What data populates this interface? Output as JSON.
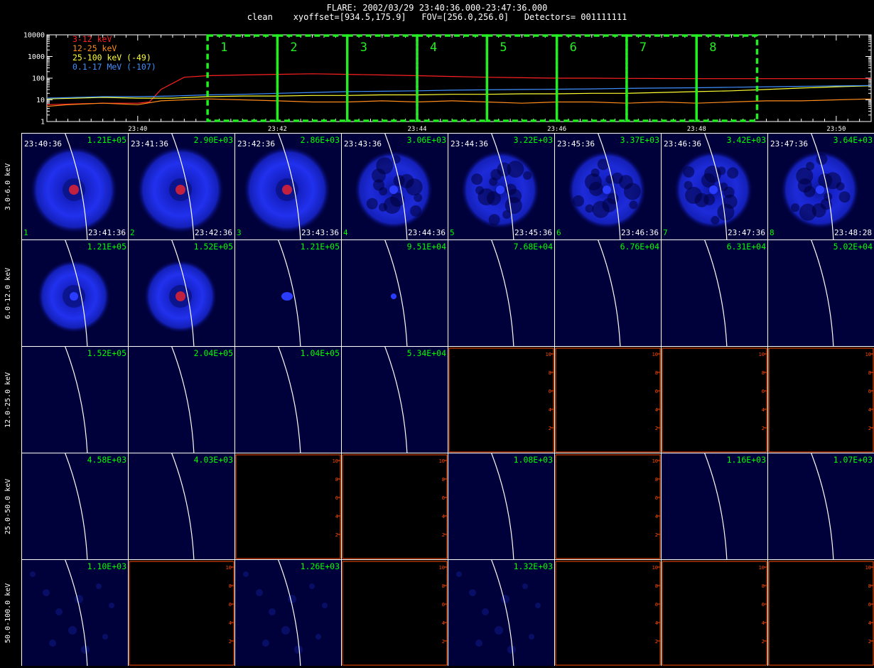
{
  "header": {
    "title": "FLARE: 2002/03/29 23:40:36.000-23:47:36.000",
    "subtitle": "clean    xyoffset=[934.5,175.9]   FOV=[256.0,256.0]   Detectors= 001111111"
  },
  "chart_data": [
    {
      "type": "line",
      "scale": "log",
      "ylim": [
        1,
        10000
      ],
      "yticks": [
        "10000",
        "1000",
        "100",
        "10",
        "1"
      ],
      "xticks": [
        "23:40",
        "23:42",
        "23:44",
        "23:46",
        "23:48",
        "23:50"
      ],
      "time_range_minutes": [
        "23:38:42",
        "23:50:30"
      ],
      "series": [
        {
          "name": "3-12 keV",
          "color": "#ff2020",
          "t": [
            "23:38:42",
            "23:39:30",
            "23:40:00",
            "23:40:10",
            "23:40:20",
            "23:40:40",
            "23:41:00",
            "23:41:30",
            "23:42:00",
            "23:42:30",
            "23:43:00",
            "23:43:30",
            "23:44:00",
            "23:44:30",
            "23:45:00",
            "23:45:30",
            "23:46:00",
            "23:46:30",
            "23:47:00",
            "23:47:30",
            "23:48:00",
            "23:48:30",
            "23:49:00",
            "23:49:30",
            "23:50:00",
            "23:50:30"
          ],
          "values": [
            6,
            7,
            7,
            8,
            30,
            110,
            130,
            140,
            150,
            160,
            150,
            140,
            130,
            120,
            110,
            105,
            100,
            100,
            98,
            96,
            95,
            95,
            95,
            95,
            95,
            95
          ]
        },
        {
          "name": "12-25 keV",
          "color": "#ff8c1a",
          "t": [
            "23:38:42",
            "23:39:00",
            "23:39:30",
            "23:40:00",
            "23:40:20",
            "23:40:40",
            "23:41:00",
            "23:41:30",
            "23:42:00",
            "23:42:30",
            "23:43:00",
            "23:43:30",
            "23:44:00",
            "23:44:30",
            "23:45:00",
            "23:45:30",
            "23:46:00",
            "23:46:30",
            "23:47:00",
            "23:47:30",
            "23:48:00",
            "23:48:30",
            "23:49:00",
            "23:49:30",
            "23:50:00",
            "23:50:30"
          ],
          "values": [
            5,
            6,
            7,
            6,
            9,
            10,
            11,
            10,
            9,
            8,
            8,
            9,
            8,
            9,
            8,
            7,
            8,
            8,
            7,
            8,
            7,
            8,
            9,
            9,
            10,
            11
          ]
        },
        {
          "name": "25-100 keV (-49)",
          "color": "#ffff33",
          "t": [
            "23:38:42",
            "23:39:30",
            "23:40:00",
            "23:40:30",
            "23:41:00",
            "23:41:30",
            "23:42:00",
            "23:42:30",
            "23:43:00",
            "23:43:30",
            "23:44:00",
            "23:44:30",
            "23:45:00",
            "23:45:30",
            "23:46:00",
            "23:46:30",
            "23:47:00",
            "23:47:30",
            "23:48:00",
            "23:48:30",
            "23:49:00",
            "23:49:30",
            "23:50:00",
            "23:50:30"
          ],
          "values": [
            11,
            13,
            12,
            12,
            14,
            15,
            15,
            16,
            16,
            17,
            17,
            18,
            18,
            19,
            19,
            20,
            20,
            22,
            24,
            26,
            30,
            35,
            40,
            45
          ]
        },
        {
          "name": "0.1-17 MeV (-107)",
          "color": "#3f8fff",
          "t": [
            "23:38:42",
            "23:39:30",
            "23:40:00",
            "23:40:30",
            "23:41:00",
            "23:41:30",
            "23:42:00",
            "23:42:30",
            "23:43:00",
            "23:43:30",
            "23:44:00",
            "23:44:30",
            "23:45:00",
            "23:45:30",
            "23:46:00",
            "23:46:30",
            "23:47:00",
            "23:47:30",
            "23:48:00",
            "23:48:30",
            "23:49:00",
            "23:49:30",
            "23:50:00",
            "23:50:30"
          ],
          "values": [
            12,
            14,
            14,
            15,
            17,
            18,
            20,
            22,
            24,
            25,
            26,
            28,
            29,
            30,
            31,
            32,
            34,
            35,
            36,
            38,
            40,
            42,
            44,
            46
          ]
        }
      ],
      "intervals": [
        {
          "label": "1",
          "start": "23:41:00",
          "end": "23:42:00"
        },
        {
          "label": "2",
          "start": "23:42:00",
          "end": "23:43:00"
        },
        {
          "label": "3",
          "start": "23:43:00",
          "end": "23:44:00"
        },
        {
          "label": "4",
          "start": "23:44:00",
          "end": "23:45:00"
        },
        {
          "label": "5",
          "start": "23:45:00",
          "end": "23:46:00"
        },
        {
          "label": "6",
          "start": "23:46:00",
          "end": "23:47:00"
        },
        {
          "label": "7",
          "start": "23:47:00",
          "end": "23:48:00"
        },
        {
          "label": "8",
          "start": "23:48:00",
          "end": "23:48:52"
        }
      ]
    },
    {
      "type": "heatmap",
      "energy_bands": [
        "3.0-6.0 keV",
        "6.0-12.0 keV",
        "12.0-25.0 keV",
        "25.0-50.0 keV",
        "50.0-100.0 keV"
      ],
      "time_start": [
        "23:40:36",
        "23:41:36",
        "23:42:36",
        "23:43:36",
        "23:44:36",
        "23:45:36",
        "23:46:36",
        "23:47:36"
      ],
      "time_end": [
        "23:41:36",
        "23:42:36",
        "23:43:36",
        "23:44:36",
        "23:45:36",
        "23:46:36",
        "23:47:36",
        "23:48:28"
      ],
      "interval_index": [
        "1",
        "2",
        "3",
        "4",
        "5",
        "6",
        "7",
        "8"
      ],
      "peaks": [
        [
          "1.21E+05",
          "2.90E+03",
          "2.86E+03",
          "3.06E+03",
          "3.22E+03",
          "3.37E+03",
          "3.42E+03",
          "3.64E+03"
        ],
        [
          "1.21E+05",
          "1.52E+05",
          "1.21E+05",
          "9.51E+04",
          "7.68E+04",
          "6.76E+04",
          "6.31E+04",
          "5.02E+04"
        ],
        [
          "1.52E+05",
          "2.04E+05",
          "1.04E+05",
          "5.34E+04",
          "",
          "",
          "",
          ""
        ],
        [
          "4.58E+03",
          "4.03E+03",
          "",
          "",
          "1.08E+03",
          "",
          "1.16E+03",
          "1.07E+03"
        ],
        [
          "1.10E+03",
          "",
          "1.26E+03",
          "",
          "1.32E+03",
          "",
          "",
          ""
        ]
      ],
      "cell_kind": [
        [
          "ring",
          "ring",
          "ring",
          "mottled",
          "mottled",
          "mottled",
          "mottled",
          "mottled"
        ],
        [
          "ring",
          "ring",
          "source",
          "source",
          "dark",
          "dark",
          "dark",
          "dark"
        ],
        [
          "dark",
          "dark",
          "dark",
          "dark",
          "empty",
          "empty",
          "empty",
          "empty"
        ],
        [
          "dark",
          "dark",
          "empty",
          "empty",
          "dark",
          "empty",
          "dark",
          "dark"
        ],
        [
          "faint",
          "empty",
          "faint",
          "empty",
          "faint",
          "empty",
          "empty",
          "empty"
        ]
      ],
      "empty_axis_ticks": [
        "2",
        "4",
        "6",
        "8",
        "10"
      ],
      "colors": {
        "image_bg": "#00003a",
        "ring": "#1f2be6",
        "core": "#c2203f",
        "peak_text": "#00ff00",
        "empty_axis": "#ff4a00",
        "limb": "#ffffff"
      }
    }
  ]
}
